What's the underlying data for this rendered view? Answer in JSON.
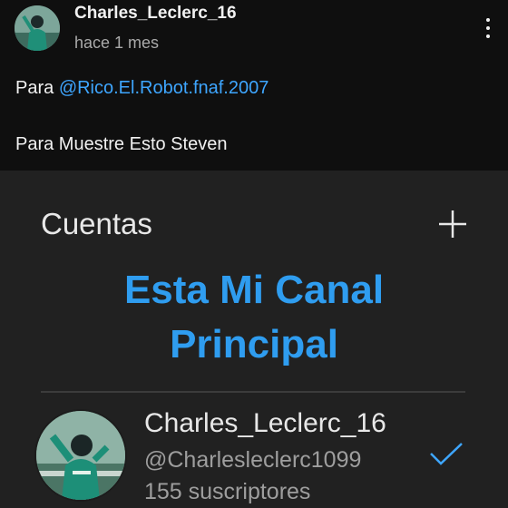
{
  "post": {
    "author": "Charles_Leclerc_16",
    "time": "hace 1 mes",
    "line1_prefix": "Para ",
    "line1_mention": "@Rico.El.Robot.fnaf.2007",
    "line2": "Para Muestre Esto Steven",
    "more_icon": "more-vert-icon"
  },
  "screenshot": {
    "title": "Cuentas",
    "add_icon": "plus-icon",
    "overlay_line1": "Esta Mi Canal",
    "overlay_line2": "Principal",
    "account": {
      "name": "Charles_Leclerc_16",
      "handle": "@Charlesleclerc1099",
      "subscribers": "155 suscriptores",
      "selected_icon": "check-icon"
    }
  },
  "colors": {
    "background": "#0f0f0f",
    "panel": "#212121",
    "mention": "#3ea6ff",
    "overlay_text": "#2f9df0",
    "check": "#3ea6ff"
  }
}
